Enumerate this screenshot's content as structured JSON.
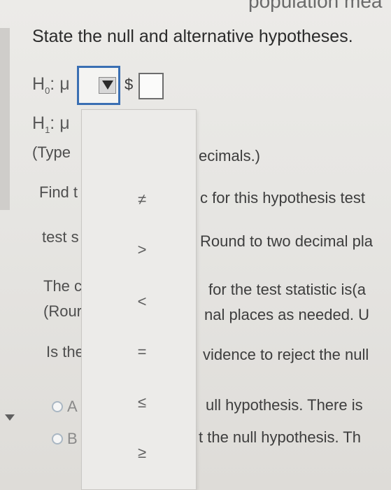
{
  "header": {
    "cut_text": "population mea",
    "title": "State the null and alternative hypotheses."
  },
  "hypotheses": {
    "h0_label": "H",
    "h0_sub": "0",
    "h0_rest": ": μ",
    "h1_label": "H",
    "h1_sub": "1",
    "h1_rest": ": μ",
    "dollar": "$",
    "input_value": ""
  },
  "dropdown": {
    "options": [
      "≠",
      ">",
      "<",
      "=",
      "≤",
      "≥"
    ]
  },
  "rows": {
    "type_left": "(Type",
    "type_right": "ecimals.)",
    "find_left": "Find t",
    "find_right": "c for this hypothesis test",
    "tests_left": "test s",
    "tests_right": "Round to two decimal pla",
    "thec_left": "The c",
    "thec_right": "for the test statistic is(a",
    "rour_left": "(Rour",
    "rour_right": "nal places as needed. U",
    "isthe_left": "Is the",
    "isthe_right": "vidence to reject the null"
  },
  "choices": {
    "a_letter": "A",
    "a_text": "ull hypothesis. There is",
    "b_letter": "B",
    "b_text": "t the null hypothesis. Th"
  }
}
